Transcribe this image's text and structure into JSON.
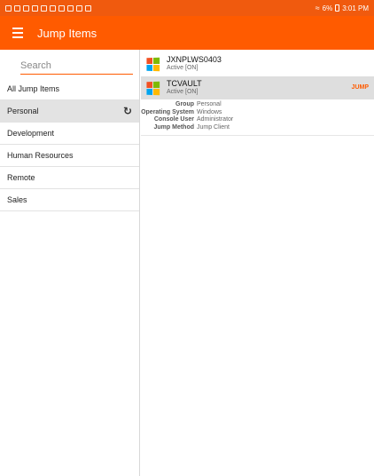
{
  "status_bar": {
    "battery_text": "6%",
    "time": "3:01 PM"
  },
  "app_bar": {
    "title": "Jump Items"
  },
  "sidebar": {
    "search_placeholder": "Search",
    "items": [
      {
        "label": "All Jump Items"
      },
      {
        "label": "Personal"
      },
      {
        "label": "Development"
      },
      {
        "label": "Human Resources"
      },
      {
        "label": "Remote"
      },
      {
        "label": "Sales"
      }
    ]
  },
  "jump_items": [
    {
      "name": "JXNPLWS0403",
      "status": "Active [ON]"
    },
    {
      "name": "TCVAULT",
      "status": "Active [ON]",
      "action": "JUMP"
    }
  ],
  "details": [
    {
      "key": "Group",
      "value": "Personal"
    },
    {
      "key": "Operating System",
      "value": "Windows"
    },
    {
      "key": "Console User",
      "value": "Administrator"
    },
    {
      "key": "Jump Method",
      "value": "Jump Client"
    }
  ],
  "colors": {
    "accent": "#ff5b00",
    "status_bar": "#f05a0e",
    "selected_bg": "#e3e3e3"
  }
}
